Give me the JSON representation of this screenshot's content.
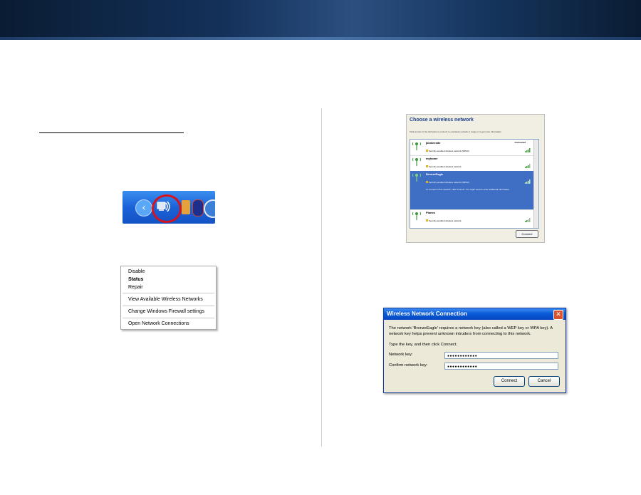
{
  "taskbar": {
    "arrow_glyph": "‹",
    "icons": [
      "expand-tray-icon",
      "wireless-network-icon",
      "speaker-icon",
      "bluetooth-icon",
      "security-alert-icon"
    ],
    "highlight_color": "#d8121a"
  },
  "context_menu": {
    "items": [
      {
        "label": "Disable",
        "bold": false
      },
      {
        "label": "Status",
        "bold": true
      },
      {
        "label": "Repair",
        "bold": false
      },
      {
        "label": "View Available Wireless Networks",
        "bold": false
      },
      {
        "label": "Change Windows Firewall settings",
        "bold": false
      },
      {
        "label": "Open Network Connections",
        "bold": false
      }
    ]
  },
  "choose_network": {
    "title": "Choose a wireless network",
    "hint": "Click an item in the list below to connect to a wireless network in range or to get more information.",
    "networks": [
      {
        "name": "jkimleesite",
        "security": "Security-enabled wireless network (WPA2)",
        "status": "Connected",
        "selected": false
      },
      {
        "name": "myhome",
        "security": "Security-enabled wireless network",
        "status": "",
        "selected": false
      },
      {
        "name": "BronzeEagle",
        "security": "Security-enabled wireless network (WPA2)",
        "status": "",
        "selected": true,
        "description": "To connect to this network, click Connect. You might need to enter additional information."
      },
      {
        "name": "Planes",
        "security": "Security-enabled wireless network",
        "status": "",
        "selected": false
      }
    ],
    "connect_label": "Connect",
    "selection_color": "#3e6fc4"
  },
  "key_dialog": {
    "title": "Wireless Network Connection",
    "message": "The network 'BronzeEagle' requires a network key (also called a WEP key or WPA key). A network key helps prevent unknown intruders from connecting to this network.",
    "prompt": "Type the key, and then click Connect.",
    "network_key_label": "Network key:",
    "network_key_value": "●●●●●●●●●●●●",
    "confirm_key_label": "Confirm network key:",
    "confirm_key_value": "●●●●●●●●●●●●",
    "connect_label": "Connect",
    "cancel_label": "Cancel",
    "close_glyph": "✕"
  }
}
